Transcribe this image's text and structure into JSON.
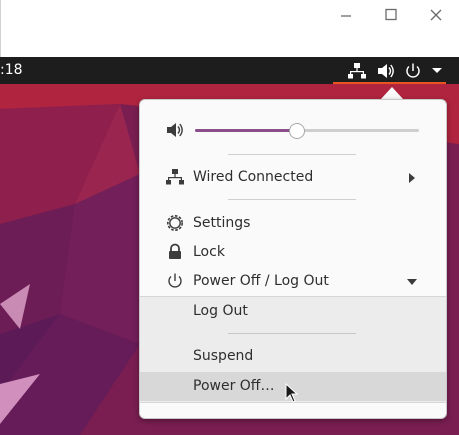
{
  "window": {
    "icons": [
      "minimize-icon",
      "maximize-icon",
      "close-icon"
    ]
  },
  "topbar": {
    "clock": ":18",
    "accent_color": "#e95420",
    "tray_icons": [
      "network-wired-icon",
      "volume-icon",
      "power-icon",
      "dropdown-arrow-icon"
    ]
  },
  "system_menu": {
    "volume": {
      "icon": "volume-icon",
      "level": 0.45
    },
    "network": {
      "label": "Wired Connected",
      "icon": "network-wired-icon"
    },
    "settings": {
      "label": "Settings",
      "icon": "gear-icon"
    },
    "lock": {
      "label": "Lock",
      "icon": "lock-icon"
    },
    "power": {
      "label": "Power Off / Log Out",
      "icon": "power-icon",
      "expanded": true,
      "submenu": {
        "log_out": "Log Out",
        "suspend": "Suspend",
        "power_off": "Power Off…"
      }
    },
    "slider_color": "#8b4d8a"
  },
  "desktop": {
    "wallpaper_color": "#7a1e52"
  }
}
